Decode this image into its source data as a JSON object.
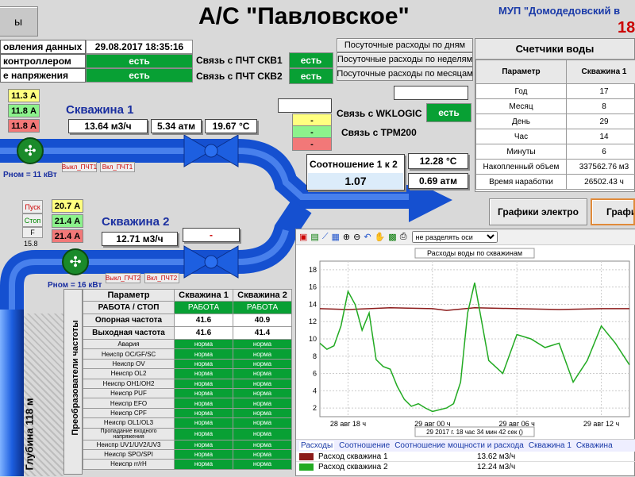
{
  "title": "А/С \"Павловское\"",
  "org": "МУП \"Домодедовский в",
  "org_num": "18",
  "top_left_btn": "ы",
  "status": {
    "rows": [
      {
        "label": "овления данных",
        "value": "29.08.2017 18:35:16"
      },
      {
        "label": "контроллером",
        "value": "есть"
      },
      {
        "label": "е напряжения",
        "value": "есть"
      }
    ],
    "pch_rows": [
      {
        "label": "Связь с ПЧТ СКВ1",
        "value": "есть"
      },
      {
        "label": "Связь с ПЧТ СКВ2",
        "value": "есть"
      }
    ]
  },
  "report_buttons": [
    "Посуточные расходы по дням",
    "Посуточные расходы по неделям",
    "Посуточные расходы по месяцам"
  ],
  "well1": {
    "name": "Скважина 1",
    "amps": [
      "11.3 А",
      "11.8 А",
      "11.8 А"
    ],
    "flow": "13.64 м3/ч",
    "pressure": "5.34 атм",
    "temp": "19.67 °C",
    "power": "Рном = 11 кВт",
    "btn_off": "Выкл_ПЧТ1",
    "btn_on": "Вкл_ПЧТ1"
  },
  "well2": {
    "name": "Скважина 2",
    "amps": [
      "20.7 А",
      "21.4 А",
      "21.4 А"
    ],
    "flow": "12.71 м3/ч",
    "extra": "-",
    "power": "Рном = 16 кВт",
    "btn_off": "Выкл_ПЧТ2",
    "btn_on": "Вкл_ПЧТ2",
    "start": "Пуск",
    "stop": "Стоп",
    "f": "F",
    "f_val": "15.8"
  },
  "links": {
    "wklogic_label": "Связь с WKLOGIC",
    "wklogic_value": "есть",
    "trm_label": "Связь с ТРМ200",
    "dash": [
      "-",
      "-",
      "-"
    ]
  },
  "ratio": {
    "label": "Соотношение 1 к 2",
    "value": "1.07"
  },
  "temp_box": "12.28 °C",
  "pressure_box": "0.69 атм",
  "depth": "Глубина 118 м",
  "meters": {
    "title": "Счетчики воды",
    "headers": [
      "Параметр",
      "Скважина 1"
    ],
    "rows": [
      [
        "Год",
        "17"
      ],
      [
        "Месяц",
        "8"
      ],
      [
        "День",
        "29"
      ],
      [
        "Час",
        "14"
      ],
      [
        "Минуты",
        "6"
      ],
      [
        "Накопленный объем",
        "337562.76 м3"
      ],
      [
        "Время наработки",
        "26502.43 ч"
      ]
    ]
  },
  "graph_buttons": [
    "Графики электро",
    "Графи"
  ],
  "freq_table": {
    "side_label": "Преобразователи частоты",
    "headers": [
      "Параметр",
      "Скважина 1",
      "Скважина 2"
    ],
    "top_rows": [
      [
        "РАБОТА / СТОП",
        "РАБОТА",
        "РАБОТА"
      ],
      [
        "Опорная частота",
        "41.6",
        "40.9"
      ],
      [
        "Выходная частота",
        "41.6",
        "41.4"
      ]
    ],
    "fault_rows": [
      "Авария",
      "Неиспр OC/GF/SC",
      "Неиспр OV",
      "Неиспр OL2",
      "Неиспр OH1/OH2",
      "Неиспр PUF",
      "Неиспр EFO",
      "Неиспр CPF",
      "Неиспр OL1/OL3",
      "Пропадание входного напряжения",
      "Неиспр UV1/UV2/UV3",
      "Неиспр SPO/SPI",
      "Неиспр rr/rH"
    ],
    "fault_value": "норма"
  },
  "chart_panel": {
    "dropdown": "не разделять оси",
    "tabs": [
      "Расходы",
      "Соотношение",
      "Соотношение мощности и расхода",
      "Скважина 1",
      "Скважина"
    ],
    "legend": [
      {
        "name": "Расход скважина 1",
        "value": "13.62 м3/ч",
        "color": "#8b1a1a"
      },
      {
        "name": "Расход скважина 2",
        "value": "12.24 м3/ч",
        "color": "#22aa22"
      }
    ]
  },
  "chart_data": {
    "type": "line",
    "title": "Расходы воды по скважинам",
    "footer": "29  2017 г. 18 час 34 мин 42 сек ()",
    "x_ticks": [
      "28 авг 18 ч",
      "29 авг 00 ч",
      "29 авг 06 ч",
      "29 авг 12 ч"
    ],
    "xlim_hours": [
      -2,
      20
    ],
    "y_ticks": [
      2,
      4,
      6,
      8,
      10,
      12,
      14,
      16,
      18
    ],
    "ylim": [
      1,
      19
    ],
    "grid": true,
    "series": [
      {
        "name": "Расход скважина 1",
        "color": "#8b1a1a",
        "x": [
          -2,
          0,
          3,
          6,
          7,
          9,
          12,
          15,
          18,
          20
        ],
        "y": [
          13.5,
          13.4,
          13.6,
          13.5,
          13.3,
          13.6,
          13.5,
          13.4,
          13.5,
          13.5
        ]
      },
      {
        "name": "Расход скважина 2",
        "color": "#22aa22",
        "x": [
          -2,
          -1.5,
          -1,
          -0.5,
          0,
          0.5,
          1,
          1.5,
          2,
          2.5,
          3,
          3.5,
          4,
          4.5,
          5,
          5.5,
          6,
          6.5,
          7,
          7.5,
          8,
          8.5,
          9,
          10,
          11,
          12,
          13,
          14,
          15,
          16,
          17,
          18,
          19,
          20
        ],
        "y": [
          9.5,
          8.8,
          9.2,
          11.5,
          15.5,
          14,
          11,
          13,
          7.6,
          6.8,
          6.5,
          4.5,
          3,
          2.2,
          2.5,
          2.0,
          1.6,
          1.8,
          2.0,
          2.5,
          5,
          13,
          16.5,
          7.5,
          6,
          10.5,
          10,
          9,
          9.5,
          5,
          7.5,
          11.5,
          9.5,
          7
        ]
      }
    ]
  }
}
